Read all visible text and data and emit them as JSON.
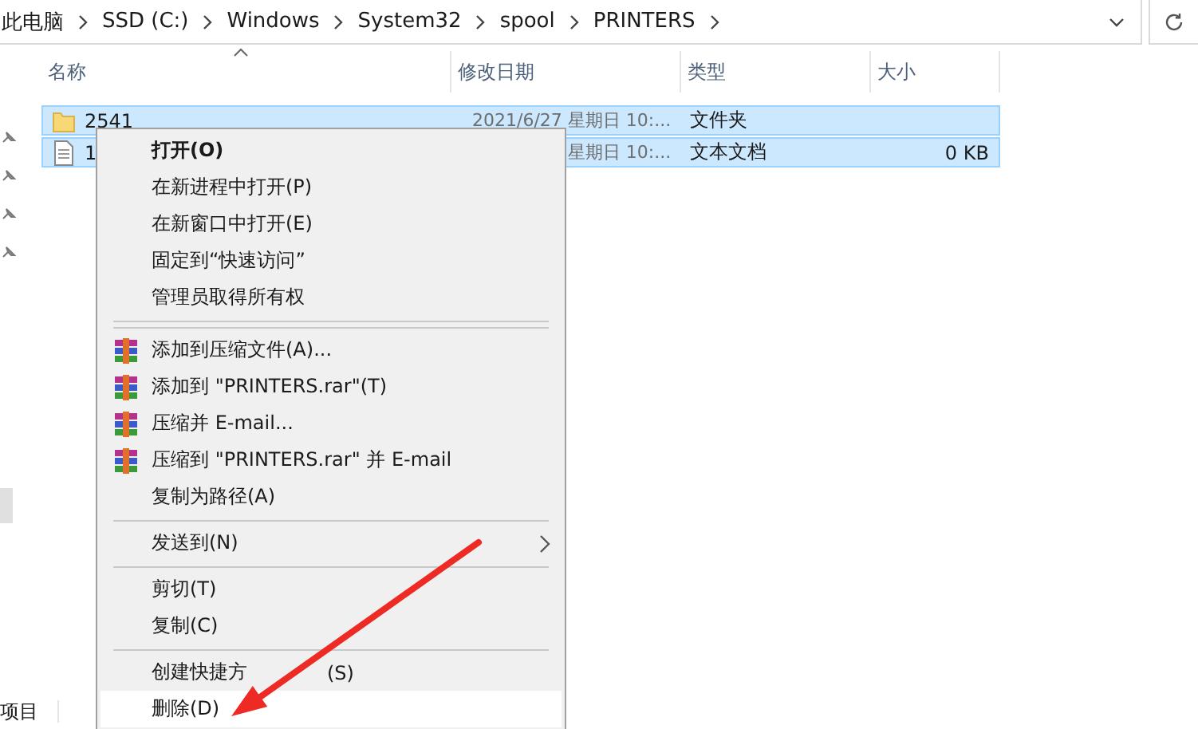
{
  "address_bar": {
    "path": [
      "此电脑",
      "SSD (C:)",
      "Windows",
      "System32",
      "spool",
      "PRINTERS"
    ]
  },
  "file_list": {
    "columns": [
      {
        "label": "名称",
        "sorted": true
      },
      {
        "label": "修改日期",
        "sorted": false
      },
      {
        "label": "类型",
        "sorted": false
      },
      {
        "label": "大小",
        "sorted": false
      }
    ],
    "rows": [
      {
        "kind": "folder",
        "selected": true,
        "name": "2541",
        "modified": "2021/6/27 星期日 10:...",
        "type": "文件夹"
      },
      {
        "kind": "text-file",
        "selected": true,
        "name": "1",
        "modified": "星期日 10:...",
        "type": "文本文档",
        "size": "0 KB"
      }
    ]
  },
  "context_menu": {
    "items": [
      {
        "kind": "item",
        "label": "打开(O)",
        "bold": true,
        "selected": false
      },
      {
        "kind": "item",
        "label": "在新进程中打开(P)",
        "bold": false,
        "selected": false
      },
      {
        "kind": "item",
        "label": "在新窗口中打开(E)",
        "bold": false,
        "selected": false
      },
      {
        "kind": "item",
        "label": "固定到“快速访问”",
        "bold": false,
        "selected": false
      },
      {
        "kind": "item",
        "label": "管理员取得所有权",
        "bold": false,
        "selected": false
      },
      {
        "kind": "separator"
      },
      {
        "kind": "separator"
      },
      {
        "kind": "archive-item",
        "label": "添加到压缩文件(A)...",
        "bold": false,
        "selected": false
      },
      {
        "kind": "archive-item",
        "label": "添加到 \"PRINTERS.rar\"(T)",
        "bold": false,
        "selected": false
      },
      {
        "kind": "archive-item",
        "label": "压缩并 E-mail...",
        "bold": false,
        "selected": false
      },
      {
        "kind": "archive-item",
        "label": "压缩到 \"PRINTERS.rar\" 并 E-mail",
        "bold": false,
        "selected": false
      },
      {
        "kind": "item",
        "label": "复制为路径(A)",
        "bold": false,
        "selected": false
      },
      {
        "kind": "separator"
      },
      {
        "kind": "submenu",
        "label": "发送到(N)",
        "bold": false,
        "selected": false
      },
      {
        "kind": "separator"
      },
      {
        "kind": "item",
        "label": "剪切(T)",
        "bold": false,
        "selected": false
      },
      {
        "kind": "item",
        "label": "复制(C)",
        "bold": false,
        "selected": false
      },
      {
        "kind": "separator"
      },
      {
        "kind": "item",
        "label": "创建快捷方",
        "label_tail": "(S)",
        "bold": false,
        "selected": false
      },
      {
        "kind": "item",
        "label": "删除(D)",
        "bold": false,
        "selected": true
      }
    ]
  },
  "status_bar": {
    "text": "项目"
  }
}
